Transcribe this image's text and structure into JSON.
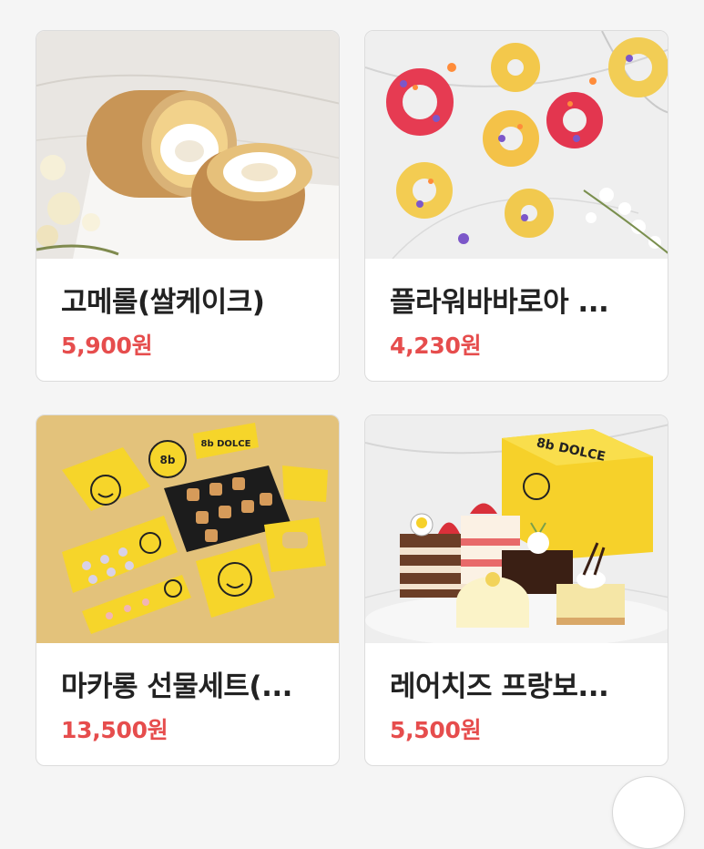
{
  "products": [
    {
      "name": "고메롤(쌀케이크)",
      "price": "5,900원"
    },
    {
      "name": "플라워바바로아 ...",
      "price": "4,230원"
    },
    {
      "name": "마카롱 선물세트(...",
      "price": "13,500원"
    },
    {
      "name": "레어치즈 프랑보...",
      "price": "5,500원"
    }
  ],
  "colors": {
    "price": "#e64d4d",
    "brand_yellow": "#f6d52a"
  },
  "images": {
    "box_label": "8b DOLCE",
    "badge_text": "8b"
  }
}
